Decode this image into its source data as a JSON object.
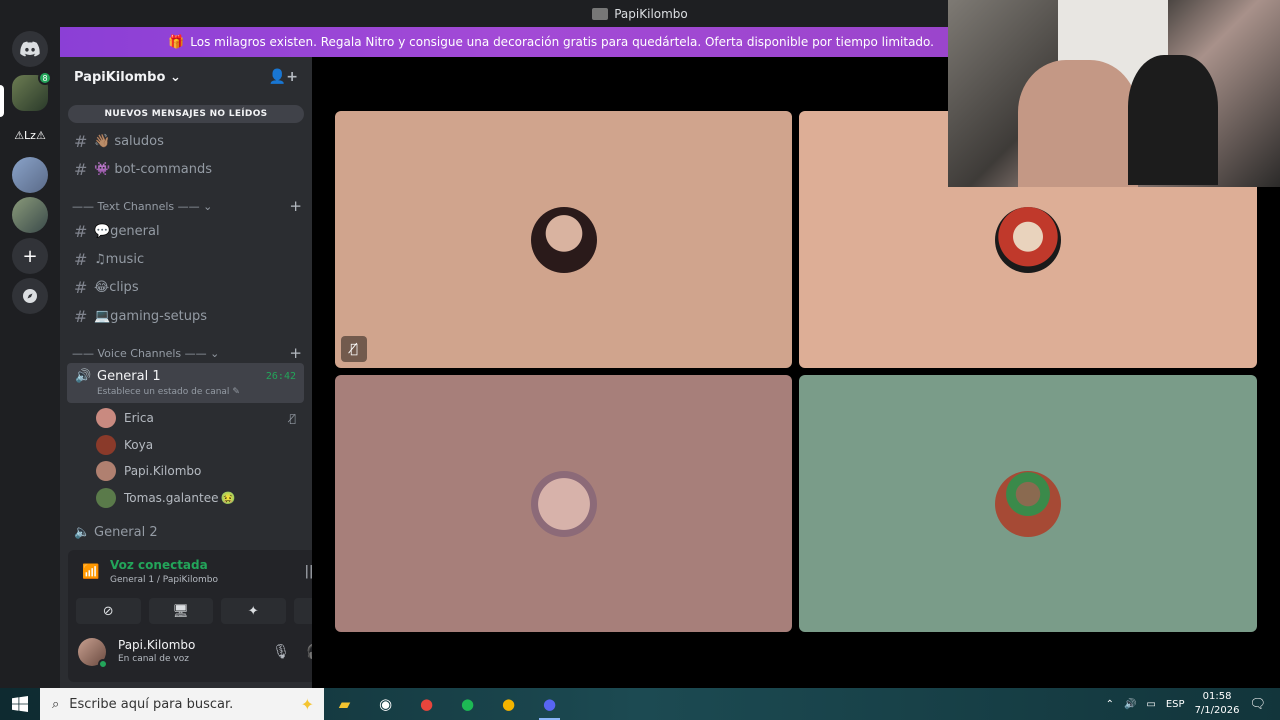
{
  "window": {
    "title": "PapiKilombo"
  },
  "banner": {
    "text": "Los milagros existen. Regala Nitro y consigue una decoración gratis para quedártela. Oferta disponible por tiempo limitado."
  },
  "guilds": {
    "g2_label": "⚠Lz⚠",
    "g1_badge": "8"
  },
  "server": {
    "name": "PapiKilombo",
    "unread_label": "NUEVOS MENSAJES NO LEÍDOS"
  },
  "channels_top": [
    {
      "name": "👋🏽 saludos"
    },
    {
      "name": "👾 bot-commands"
    }
  ],
  "categories": {
    "text": "Text Channels",
    "voice": "Voice Channels"
  },
  "text_channels": [
    {
      "name": "💬general"
    },
    {
      "name": "♫music"
    },
    {
      "name": "😂clips"
    },
    {
      "name": "💻gaming-setups"
    }
  ],
  "voice_channels": {
    "active": {
      "name": "General 1",
      "time": "26:42",
      "status": "Establece un estado de canal"
    },
    "members": [
      {
        "name": "Erica",
        "color": "#c98a80",
        "muted": true
      },
      {
        "name": "Koya",
        "color": "#8a3a2a",
        "muted": false
      },
      {
        "name": "Papi.Kilombo",
        "color": "#b08070",
        "muted": false
      },
      {
        "name": "Tomas.galantee",
        "color": "#5a7a4a",
        "muted": false
      }
    ],
    "other": {
      "name": "General 2"
    }
  },
  "voice_panel": {
    "status": "Voz conectada",
    "sub": "General 1 / PapiKilombo"
  },
  "user": {
    "name": "Papi.Kilombo",
    "status": "En canal de voz"
  },
  "tiles": [
    {
      "color": "#d0a48d",
      "avatar_color": "#3a2a2a",
      "muted": true
    },
    {
      "color": "#ddae96",
      "avatar_color": "#c0392b",
      "muted": false
    },
    {
      "color": "#a77f7a",
      "avatar_color": "#caa6a0",
      "muted": false
    },
    {
      "color": "#7a9c89",
      "avatar_color": "#a64a35",
      "muted": false
    }
  ],
  "taskbar": {
    "search_placeholder": "Escribe aquí para buscar.",
    "lang": "ESP",
    "time": "01:58",
    "date": "7/1/2026"
  },
  "colors": {
    "accent_green": "#23a55a",
    "blurple": "#5865f2"
  }
}
